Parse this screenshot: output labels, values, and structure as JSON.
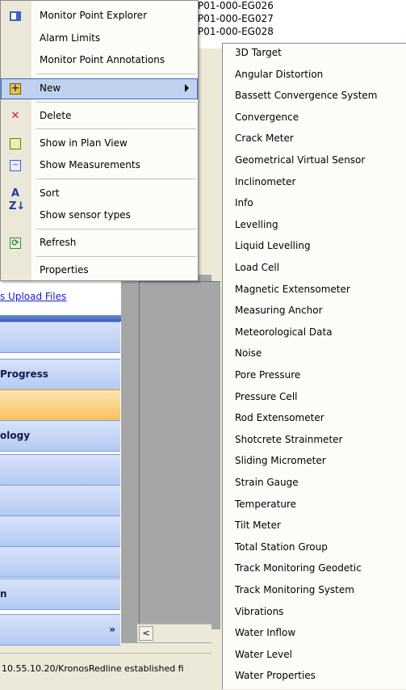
{
  "background": {
    "list_items": [
      "P01-000-EG026",
      "P01-000-EG027",
      "P01-000-EG028"
    ],
    "upload_link": "s Upload Files",
    "nav_items": [
      {
        "label": ""
      },
      {
        "label": " Progress"
      },
      {
        "label": "",
        "selected": true
      },
      {
        "label": "ology"
      },
      {
        "label": ""
      },
      {
        "label": ""
      },
      {
        "label": ""
      },
      {
        "label": ""
      },
      {
        "label": "n"
      },
      {
        "label": ""
      }
    ],
    "nav_chevron": "»",
    "scroll_left_arrow": "<",
    "status_text": "10.55.10.20/KronosRedline established fi"
  },
  "context_menu": {
    "items": [
      {
        "label": "Monitor Point Explorer",
        "icon": "explorer-icon"
      },
      {
        "label": "Alarm Limits",
        "icon": ""
      },
      {
        "label": "Monitor Point Annotations",
        "icon": ""
      },
      {
        "label": "New",
        "icon": "new-icon",
        "highlighted": true,
        "has_submenu": true
      },
      {
        "label": "Delete",
        "icon": "delete-icon"
      },
      {
        "label": "Show in Plan View",
        "icon": "plan-view-icon"
      },
      {
        "label": "Show Measurements",
        "icon": "measurements-icon"
      },
      {
        "label": "Sort",
        "icon": "sort-icon"
      },
      {
        "label": "Show sensor types",
        "icon": ""
      },
      {
        "label": "Refresh",
        "icon": "refresh-icon"
      },
      {
        "label": "Properties",
        "icon": ""
      }
    ]
  },
  "submenu": {
    "items": [
      "3D Target",
      "Angular Distortion",
      "Bassett Convergence System",
      "Convergence",
      "Crack Meter",
      "Geometrical Virtual Sensor",
      "Inclinometer",
      "Info",
      "Levelling",
      "Liquid Levelling",
      "Load Cell",
      "Magnetic Extensometer",
      "Measuring Anchor",
      "Meteorological Data",
      "Noise",
      "Pore Pressure",
      "Pressure Cell",
      "Rod Extensometer",
      "Shotcrete Strainmeter",
      "Sliding Micrometer",
      "Strain Gauge",
      "Temperature",
      "Tilt Meter",
      "Total Station Group",
      "Track Monitoring Geodetic",
      "Track Monitoring System",
      "Vibrations",
      "Water Inflow",
      "Water Level",
      "Water Properties"
    ]
  },
  "colors": {
    "highlight": "#c1d2ee",
    "highlight_border": "#316ac5",
    "nav_selected": "#f6c25f",
    "nav_blue": "#b5c9f2",
    "link": "#1a1ad0",
    "workspace": "#a6a6a6"
  }
}
